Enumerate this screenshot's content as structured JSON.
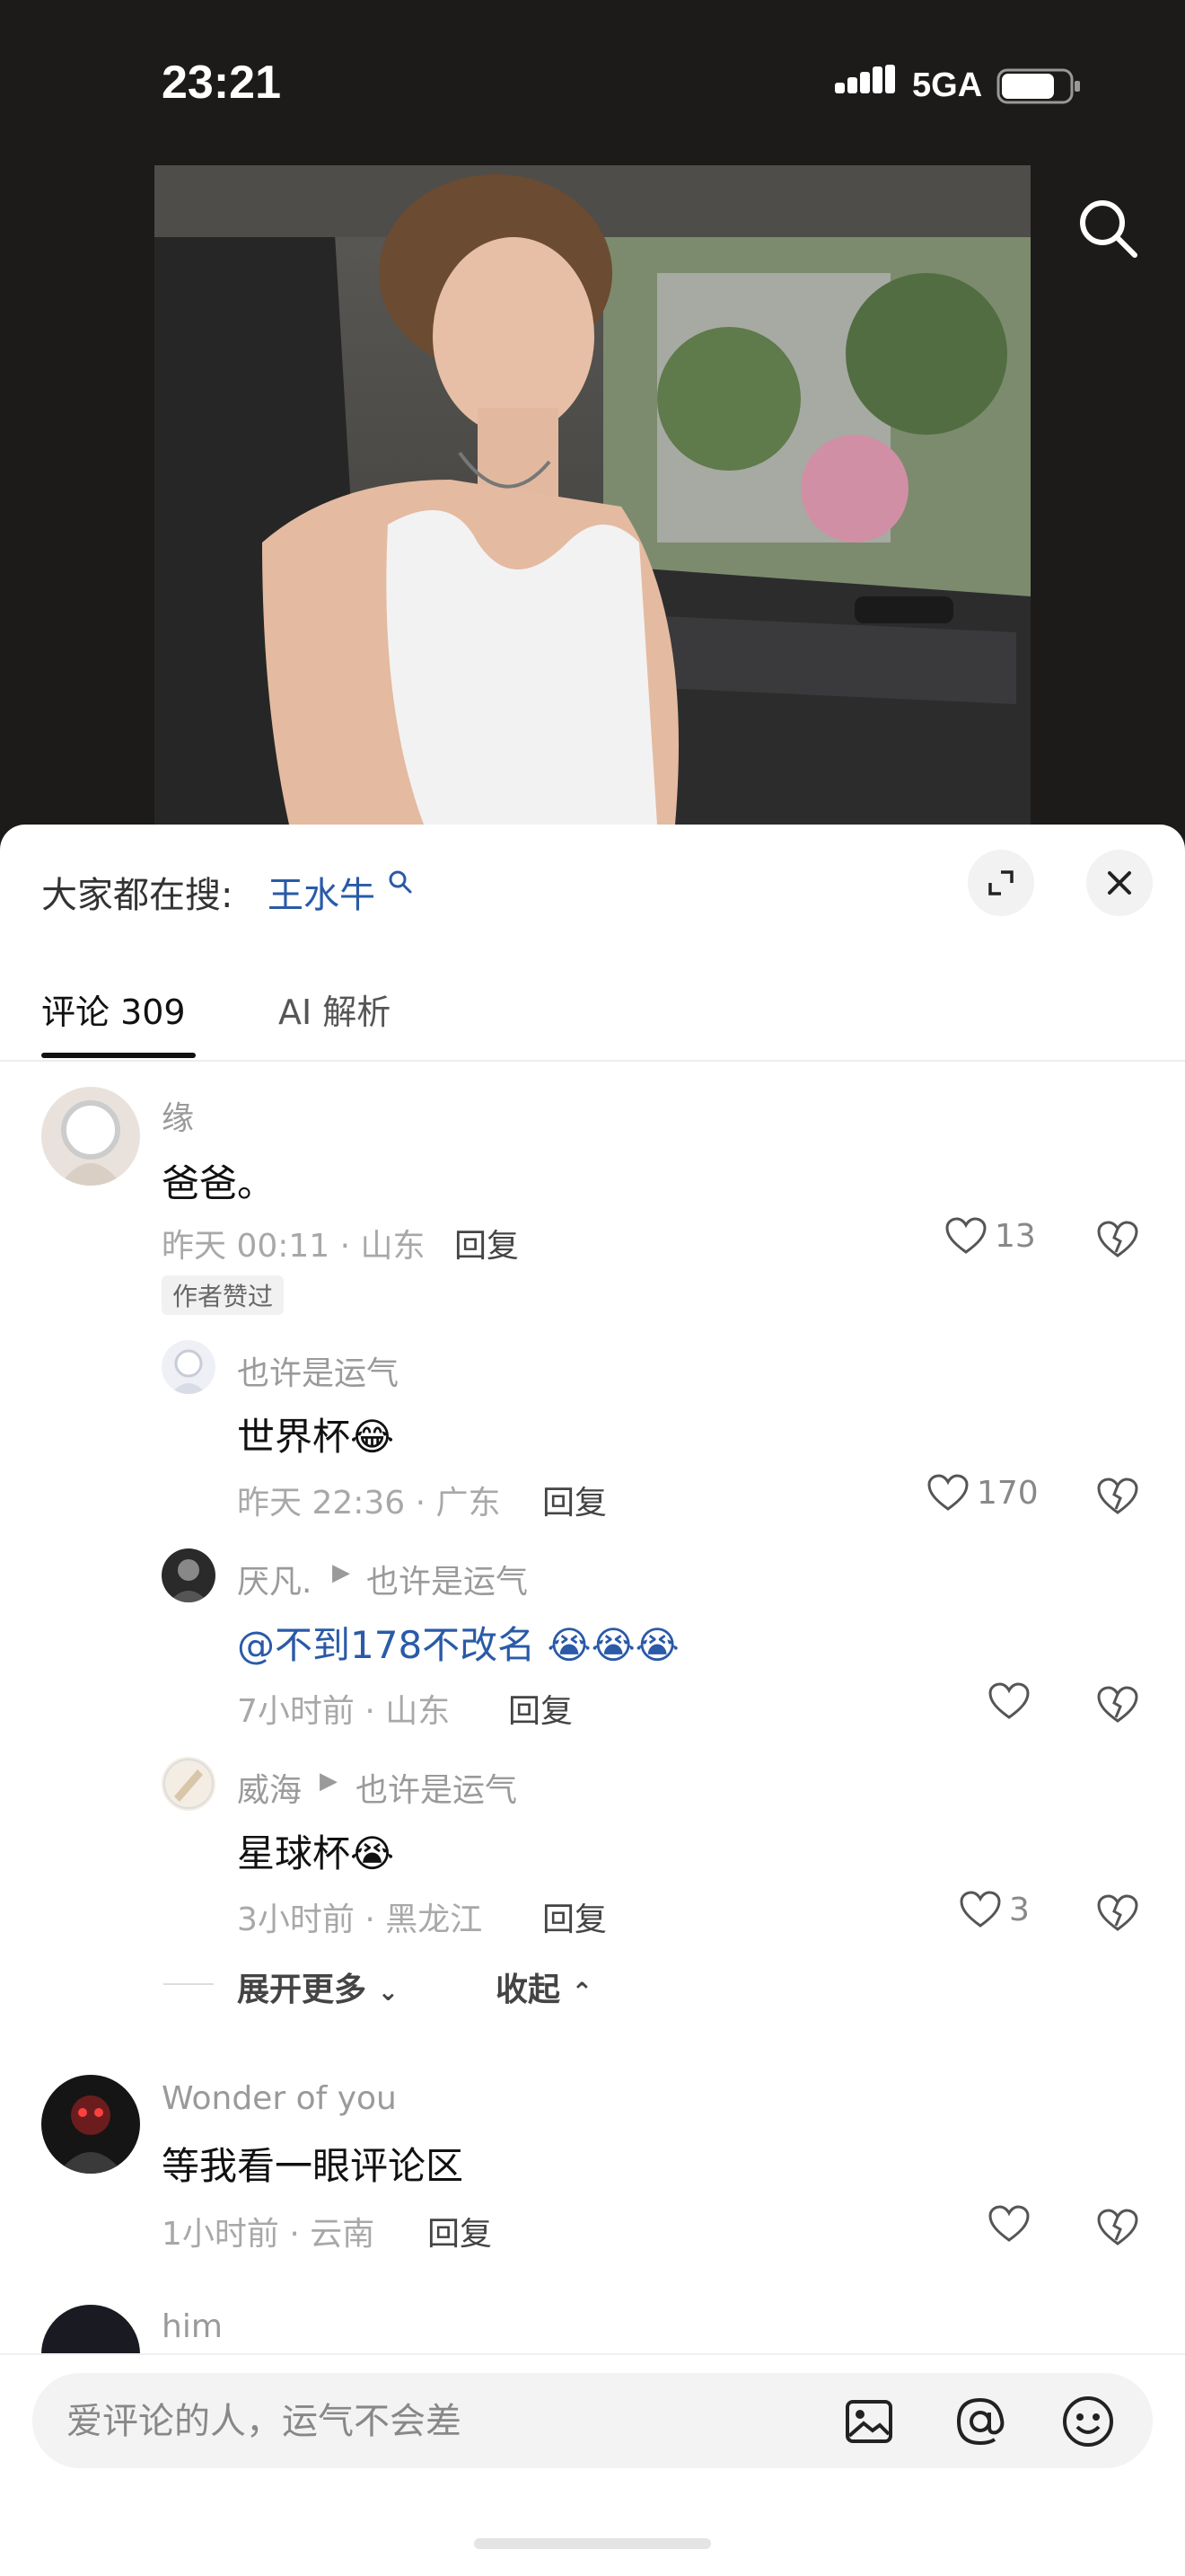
{
  "status_bar": {
    "time": "23:21",
    "network": "5GA"
  },
  "hot_search": {
    "prefix": "大家都在搜:",
    "keyword": "王水牛"
  },
  "tabs": [
    {
      "label": "评论 309"
    },
    {
      "label": "AI 解析"
    }
  ],
  "comments": [
    {
      "user": "缘",
      "text": "爸爸。",
      "meta": "昨天 00:11 · 山东",
      "reply": "回复",
      "likes": "13",
      "badge": "作者赞过"
    },
    {
      "user": "也许是运气",
      "text": "世界杯😂",
      "meta": "昨天 22:36 · 广东",
      "reply": "回复",
      "likes": "170"
    },
    {
      "user": "厌凡.",
      "reply_to": "也许是运气",
      "text": "@不到178不改名 😭😭😭",
      "meta": "7小时前 · 山东",
      "reply": "回复",
      "likes": ""
    },
    {
      "user": "威海",
      "reply_to": "也许是运气",
      "text": "星球杯😭",
      "meta": "3小时前 · 黑龙江",
      "reply": "回复",
      "likes": "3"
    },
    {
      "user": "Wonder of you",
      "text": "等我看一眼评论区",
      "meta": "1小时前 · 云南",
      "reply": "回复",
      "likes": ""
    },
    {
      "user": "him"
    }
  ],
  "expand": {
    "more": "展开更多",
    "collapse": "收起"
  },
  "input": {
    "placeholder": "爱评论的人，运气不会差"
  },
  "icons": {
    "search": "search-icon",
    "expand": "expand-icon",
    "close": "close-icon",
    "like": "heart-icon",
    "dislike": "broken-heart-icon",
    "image": "image-icon",
    "mention": "at-icon",
    "emoji": "emoji-icon"
  },
  "colors": {
    "link": "#2a5aa8",
    "meta": "#a8a8a8"
  }
}
